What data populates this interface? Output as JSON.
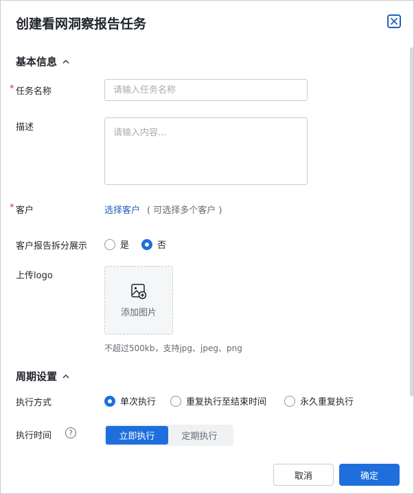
{
  "dialog": {
    "title": "创建看网洞察报告任务",
    "close_icon": "close-icon"
  },
  "basic": {
    "section_title": "基本信息",
    "task_name": {
      "required_mark": "*",
      "label": "任务名称",
      "placeholder": "请输入任务名称",
      "value": ""
    },
    "description": {
      "label": "描述",
      "placeholder": "请输入内容...",
      "value": ""
    },
    "customer": {
      "required_mark": "*",
      "label": "客户",
      "link": "选择客户",
      "hint": "( 可选择多个客户 )"
    },
    "split_display": {
      "label": "客户报告拆分展示",
      "options": [
        "是",
        "否"
      ],
      "selected": "否"
    },
    "logo": {
      "label": "上传logo",
      "upload_text": "添加图片",
      "hint": "不超过500kb，支持jpg、jpeg、png",
      "icon": "image-add-icon"
    }
  },
  "cycle": {
    "section_title": "周期设置",
    "exec_mode": {
      "label": "执行方式",
      "options": [
        "单次执行",
        "重复执行至结束时间",
        "永久重复执行"
      ],
      "selected": "单次执行"
    },
    "exec_time": {
      "label": "执行时间",
      "help": "?",
      "options": [
        "立即执行",
        "定期执行"
      ],
      "selected": "立即执行"
    }
  },
  "footer": {
    "cancel": "取消",
    "confirm": "确定"
  },
  "colors": {
    "primary": "#1e6fdc",
    "link": "#1e5fbf",
    "required": "#e02d2d"
  }
}
